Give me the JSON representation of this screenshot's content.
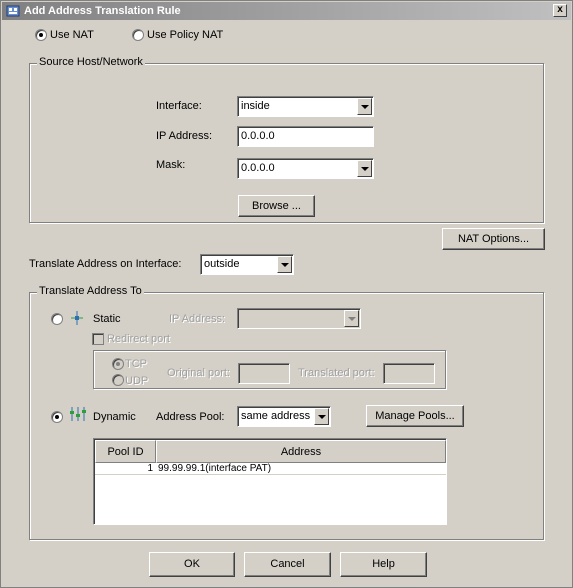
{
  "window": {
    "title": "Add Address Translation Rule",
    "close_glyph": "x"
  },
  "mode": {
    "use_nat_label": "Use NAT",
    "use_policy_nat_label": "Use Policy NAT",
    "selected": "use_nat"
  },
  "source": {
    "group_label": "Source Host/Network",
    "interface_label": "Interface:",
    "interface_value": "inside",
    "ip_label": "IP Address:",
    "ip_value": "0.0.0.0",
    "mask_label": "Mask:",
    "mask_value": "0.0.0.0",
    "browse_label": "Browse ..."
  },
  "nat_options_label": "NAT Options...",
  "translate_interface": {
    "label": "Translate Address on Interface:",
    "value": "outside"
  },
  "translate_to": {
    "group_label": "Translate Address To",
    "static": {
      "label": "Static",
      "ip_label": "IP Address:",
      "ip_value": "",
      "redirect_label": "Redirect port",
      "tcp_label": "TCP",
      "udp_label": "UDP",
      "original_port_label": "Original port:",
      "original_port_value": "",
      "translated_port_label": "Translated port:",
      "translated_port_value": ""
    },
    "dynamic": {
      "label": "Dynamic",
      "pool_label": "Address Pool:",
      "pool_value": "same address",
      "manage_label": "Manage Pools..."
    },
    "selected": "dynamic",
    "table": {
      "columns": [
        "Pool ID",
        "Address"
      ],
      "rows": [
        {
          "pool_id": "1",
          "address": "99.99.99.1(interface PAT)"
        }
      ]
    }
  },
  "buttons": {
    "ok": "OK",
    "cancel": "Cancel",
    "help": "Help"
  },
  "icons": {
    "title": "app-window-icon",
    "static": "static-translation-icon",
    "dynamic": "dynamic-translation-icon"
  }
}
